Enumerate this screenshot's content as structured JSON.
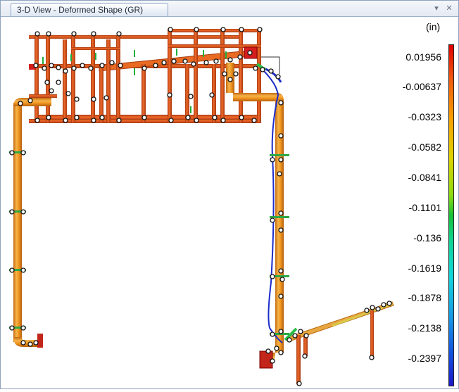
{
  "window": {
    "tab_title": "3-D View - Deformed Shape (GR)",
    "dropdown_icon": "chevron-down-icon",
    "close_icon": "close-icon"
  },
  "legend": {
    "units": "(in)",
    "values": [
      "0.01956",
      "-0.00637",
      "-0.0323",
      "-0.0582",
      "-0.0841",
      "-0.1101",
      "-0.136",
      "-0.1619",
      "-0.1878",
      "-0.2138",
      "-0.2397"
    ]
  },
  "colors": {
    "pipe_orange": "#f0a030",
    "frame_red": "#e0541a",
    "support_green": "#22c24a",
    "tension_blue": "#1a2cc8"
  }
}
